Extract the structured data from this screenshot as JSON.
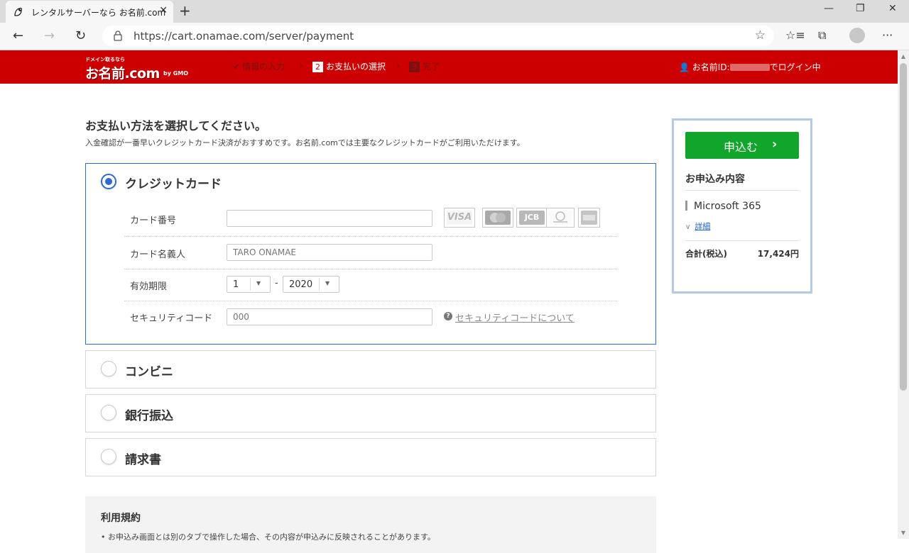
{
  "browser": {
    "tab_title": "レンタルサーバーなら お名前.com",
    "url": "https://cart.onamae.com/server/payment"
  },
  "header": {
    "logo_tagline": "ドメイン取るなら",
    "logo_text": "お名前.com",
    "logo_gmo": "by GMO",
    "steps": [
      {
        "num": "",
        "label": "情報の入力",
        "state": "done"
      },
      {
        "num": "2",
        "label": "お支払いの選択",
        "state": "active"
      },
      {
        "num": "3",
        "label": "完了",
        "state": "pending"
      }
    ],
    "login_prefix": "お名前ID:",
    "login_suffix": "でログイン中"
  },
  "main": {
    "title": "お支払い方法を選択してください。",
    "description": "入金確認が一番早いクレジットカード決済がおすすめです。お名前.comでは主要なクレジットカードがご利用いただけます。",
    "options": [
      {
        "label": "クレジットカード",
        "selected": true
      },
      {
        "label": "コンビニ",
        "selected": false
      },
      {
        "label": "銀行振込",
        "selected": false
      },
      {
        "label": "請求書",
        "selected": false
      }
    ],
    "credit_form": {
      "card_number_label": "カード番号",
      "card_number_value": "",
      "card_name_label": "カード名義人",
      "card_name_placeholder": "TARO ONAMAE",
      "expiry_label": "有効期限",
      "expiry_month": "1",
      "expiry_separator": "-",
      "expiry_year": "2020",
      "security_label": "セキュリティコード",
      "security_placeholder": "000",
      "security_help": "セキュリティコードについて",
      "card_brands": [
        "VISA",
        "Mastercard",
        "JCB",
        "Diners Club",
        "American Express"
      ]
    },
    "terms": {
      "heading": "利用規約",
      "first_line": "• お申込み画面とは別のタブで操作した場合、その内容が申込みに反映されることがあります。"
    }
  },
  "summary": {
    "apply_label": "申込む",
    "heading": "お申込み内容",
    "item": "Microsoft 365",
    "detail_link": "詳細",
    "total_label": "合計(税込)",
    "total_value": "17,424円"
  },
  "colors": {
    "brand_red": "#cc0000",
    "apply_green": "#11a52c",
    "selected_blue": "#2e6cc8"
  }
}
